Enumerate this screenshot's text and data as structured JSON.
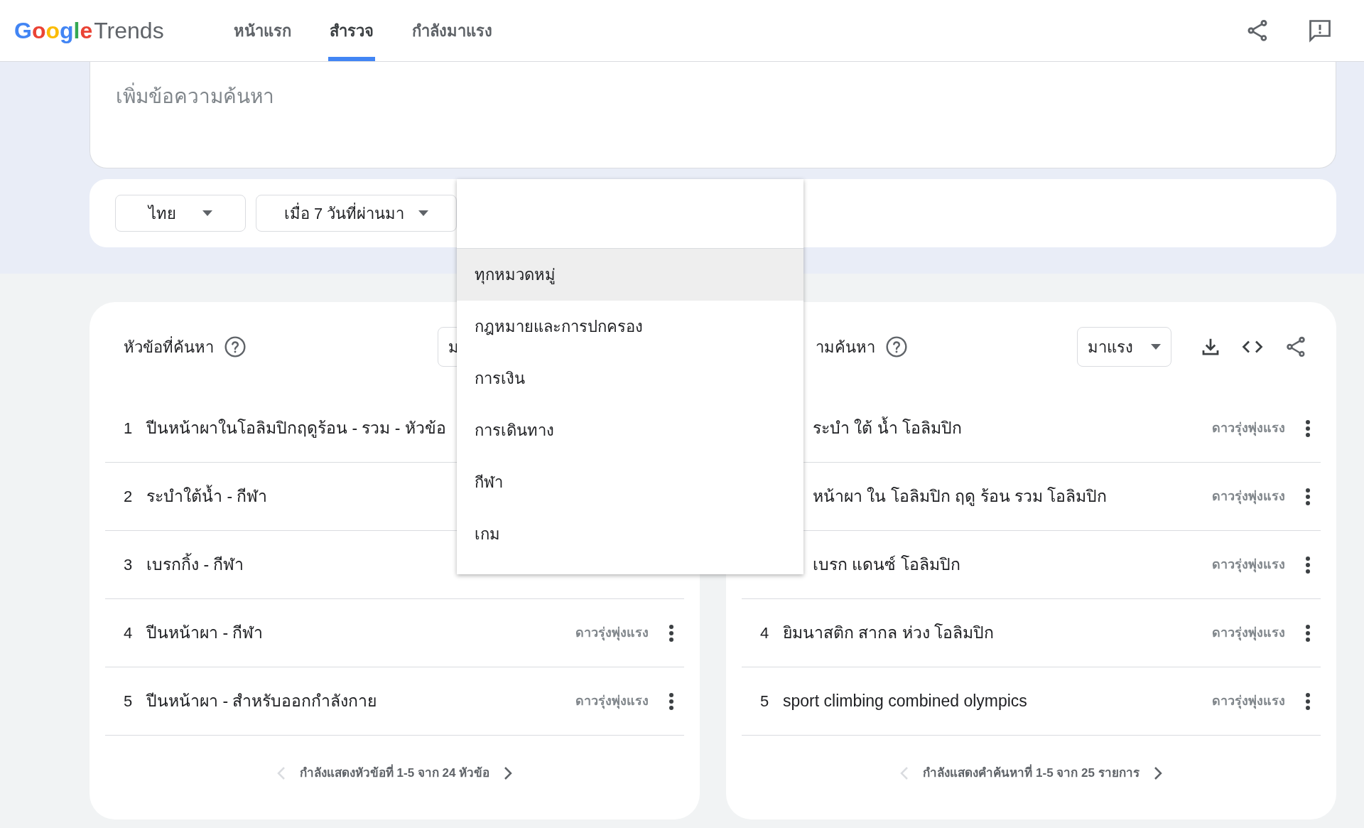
{
  "header": {
    "logo": {
      "brand": "Google",
      "product": "Trends"
    },
    "tabs": [
      {
        "label": "หน้าแรก",
        "selected": false
      },
      {
        "label": "สำรวจ",
        "selected": true
      },
      {
        "label": "กำลังมาแรง",
        "selected": false
      }
    ]
  },
  "search": {
    "placeholder": "เพิ่มข้อความค้นหา"
  },
  "filters": [
    {
      "label": "ไทย"
    },
    {
      "label": "เมื่อ 7 วันที่ผ่านมา"
    }
  ],
  "category_menu": {
    "items": [
      {
        "label": "ทุกหมวดหมู่",
        "selected": true
      },
      {
        "label": "กฎหมายและการปกครอง",
        "selected": false
      },
      {
        "label": "การเงิน",
        "selected": false
      },
      {
        "label": "การเดินทาง",
        "selected": false
      },
      {
        "label": "กีฬา",
        "selected": false
      },
      {
        "label": "เกม",
        "selected": false
      }
    ]
  },
  "panels": [
    {
      "kind": "full",
      "title": "หัวข้อที่ค้นหา",
      "selector": {
        "label": "ม"
      },
      "tools": false,
      "rows": [
        {
          "kind": "full",
          "rank": "1",
          "text": "ปีนหน้าผาในโอลิมปิกฤดูร้อน - รวม - หัวข้อ"
        },
        {
          "kind": "full",
          "rank": "2",
          "text": "ระบำใต้น้ำ - กีฬา"
        },
        {
          "kind": "full",
          "rank": "3",
          "text": "เบรกกิ้ง - กีฬา"
        },
        {
          "kind": "full",
          "rank": "4",
          "text": "ปีนหน้าผา - กีฬา",
          "badge": "ดาวรุ่งพุ่งแรง"
        },
        {
          "kind": "full",
          "rank": "5",
          "text": "ปีนหน้าผา - สำหรับออกกำลังกาย",
          "badge": "ดาวรุ่งพุ่งแรง"
        }
      ],
      "footer": "กำลังแสดงหัวข้อที่ 1-5 จาก 24 หัวข้อ"
    },
    {
      "kind": "covered",
      "title": "ามค้นหา",
      "selector": {
        "label": "มาแรง"
      },
      "tools": true,
      "rows": [
        {
          "kind": "covered",
          "text": "ระบำ ใต้ น้ำ โอลิมปิก",
          "badge": "ดาวรุ่งพุ่งแรง"
        },
        {
          "kind": "covered",
          "text": "หน้าผา ใน โอลิมปิก ฤดู ร้อน รวม โอลิมปิก",
          "badge": "ดาวรุ่งพุ่งแรง"
        },
        {
          "kind": "covered",
          "text": "เบรก แดนซ์ โอลิมปิก",
          "badge": "ดาวรุ่งพุ่งแรง"
        },
        {
          "kind": "full",
          "rank": "4",
          "text": "ยิมนาสติก สากล ห่วง โอลิมปิก",
          "badge": "ดาวรุ่งพุ่งแรง"
        },
        {
          "kind": "full",
          "rank": "5",
          "text": "sport climbing combined olympics",
          "badge": "ดาวรุ่งพุ่งแรง"
        }
      ],
      "footer": "กำลังแสดงคำค้นหาที่ 1-5 จาก 25 รายการ"
    }
  ]
}
